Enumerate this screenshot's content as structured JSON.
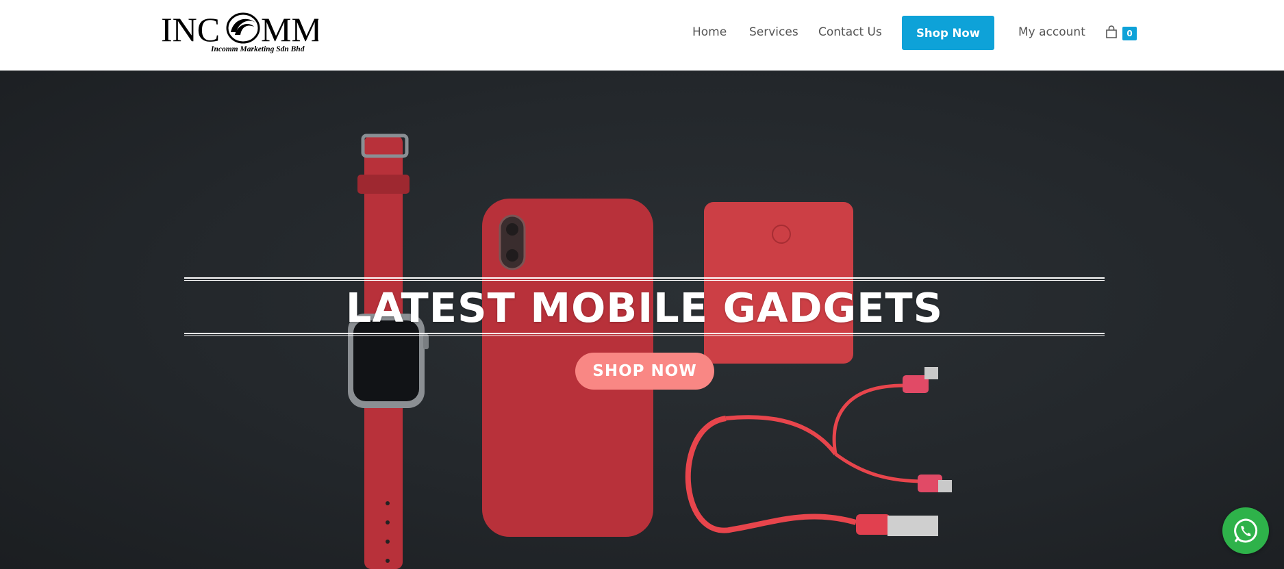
{
  "brand": {
    "logo_text": "INCOMM",
    "logo_subtitle": "Incomm Marketing Sdn Bhd"
  },
  "nav": {
    "home": "Home",
    "services": "Services",
    "contact": "Contact Us",
    "shop_now": "Shop Now",
    "account": "My account",
    "cart_count": "0",
    "cart_icon": "shopping-bag-icon"
  },
  "hero": {
    "title": "LATEST MOBILE GADGETS",
    "cta": "SHOP NOW",
    "image": "red-watch-phone-case-powerbank-cable-photo"
  },
  "floating": {
    "whatsapp_icon": "whatsapp-icon"
  },
  "colors": {
    "accent": "#0ea2d8",
    "cta": "#f98784",
    "whatsapp": "#2eb24a"
  }
}
